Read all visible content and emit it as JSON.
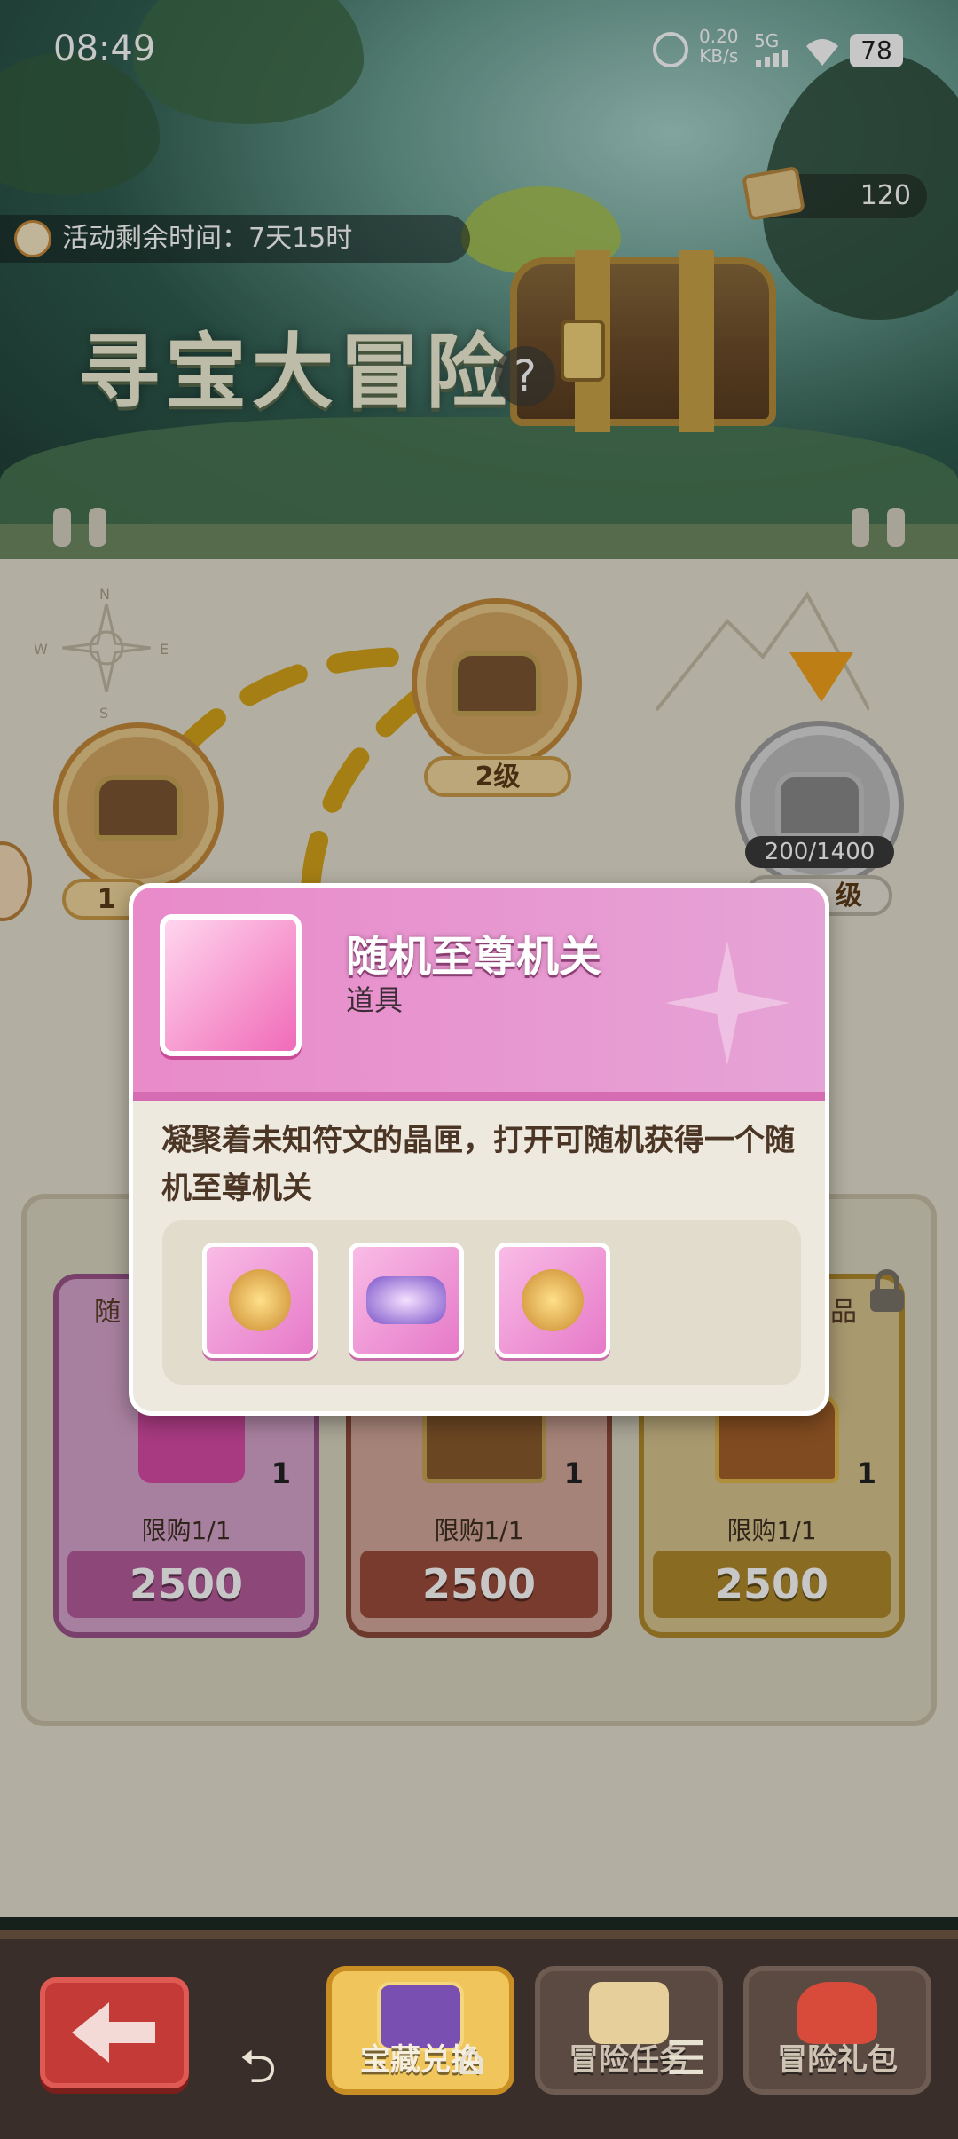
{
  "status_bar": {
    "time": "08:49",
    "net_speed_top": "0.20",
    "net_speed_unit": "KB/s",
    "network": "5G",
    "battery": "78"
  },
  "header": {
    "timer_text": "活动剩余时间：7天15时",
    "scroll_count": "120",
    "title": "寻宝大冒险",
    "help_symbol": "?"
  },
  "map": {
    "node1_level": "1",
    "node2_level": "2级",
    "node3_progress": "200/1400",
    "node3_level": "级",
    "compass_letters": [
      "N",
      "W",
      "E",
      "S"
    ]
  },
  "shop": {
    "cards": [
      {
        "name": "随",
        "count": "1",
        "limit": "限购1/1",
        "price": "2500",
        "theme": "pink"
      },
      {
        "name": "",
        "count": "1",
        "limit": "限购1/1",
        "price": "2500",
        "theme": "red"
      },
      {
        "name": "品",
        "count": "1",
        "limit": "限购1/1",
        "price": "2500",
        "theme": "gold"
      }
    ]
  },
  "popup": {
    "title": "随机至尊机关",
    "type": "道具",
    "description": "凝聚着未知符文的晶匣，打开可随机获得一个随机至尊机关",
    "rewards": [
      "lantern-icon",
      "cannon-icon",
      "gear-shield-icon"
    ]
  },
  "bottom_nav": {
    "back_icon": "back-arrow-icon",
    "tabs": [
      {
        "label": "宝藏兑换",
        "active": true,
        "icon": "treasure-chest-icon"
      },
      {
        "label": "冒险任务",
        "active": false,
        "icon": "quest-scroll-icon"
      },
      {
        "label": "冒险礼包",
        "active": false,
        "icon": "gift-bag-icon"
      }
    ]
  },
  "system_nav": {
    "back_symbol": "⮌",
    "home_symbol": "⌂",
    "menu_symbol": "☰"
  },
  "colors": {
    "accent_pink": "#e98ac9",
    "gold": "#d4a21a",
    "board": "#e4dfcf"
  }
}
